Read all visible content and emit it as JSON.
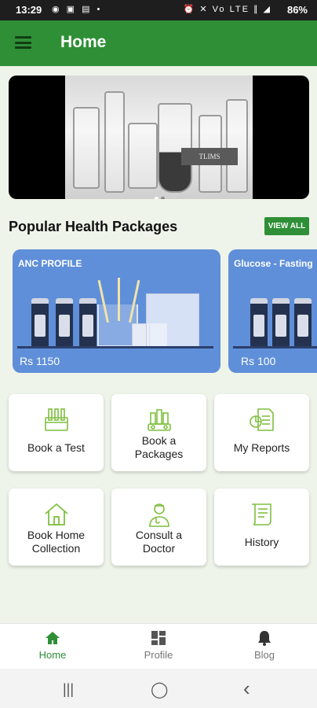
{
  "status": {
    "time": "13:29",
    "battery": "86%",
    "left_icons": "◉ ▣ ▤ •",
    "right_icons": "⏰ ✕ Vo LTE ∥ ◢"
  },
  "appbar": {
    "title": "Home"
  },
  "banner": {
    "tag": "TLIMS"
  },
  "section": {
    "title": "Popular Health Packages",
    "view_all": "VIEW ALL"
  },
  "packages": [
    {
      "name": "ANC PROFILE",
      "price": "Rs 1150"
    },
    {
      "name": "Glucose - Fasting",
      "price": "Rs 100"
    }
  ],
  "tiles": [
    {
      "label_lines": [
        "Book a Test"
      ],
      "icon": "test-tubes-icon"
    },
    {
      "label_lines": [
        "Book a",
        "Packages"
      ],
      "icon": "package-tubes-icon"
    },
    {
      "label_lines": [
        "My Reports"
      ],
      "icon": "report-chart-icon"
    },
    {
      "label_lines": [
        "Book Home",
        "Collection"
      ],
      "icon": "home-icon"
    },
    {
      "label_lines": [
        "Consult a",
        "Doctor"
      ],
      "icon": "doctor-icon"
    },
    {
      "label_lines": [
        "History"
      ],
      "icon": "scroll-icon"
    }
  ],
  "bottom_nav": [
    {
      "label": "Home",
      "icon": "home-icon",
      "active": true
    },
    {
      "label": "Profile",
      "icon": "grid-icon",
      "active": false
    },
    {
      "label": "Blog",
      "icon": "bell-icon",
      "active": false
    }
  ],
  "system_nav": {
    "recents": "|||",
    "home": "◯",
    "back": "‹"
  },
  "colors": {
    "primary": "#2f8f36",
    "card": "#5f8fd9",
    "background": "#eef4ea",
    "tile_icon": "#7fbf3f"
  }
}
